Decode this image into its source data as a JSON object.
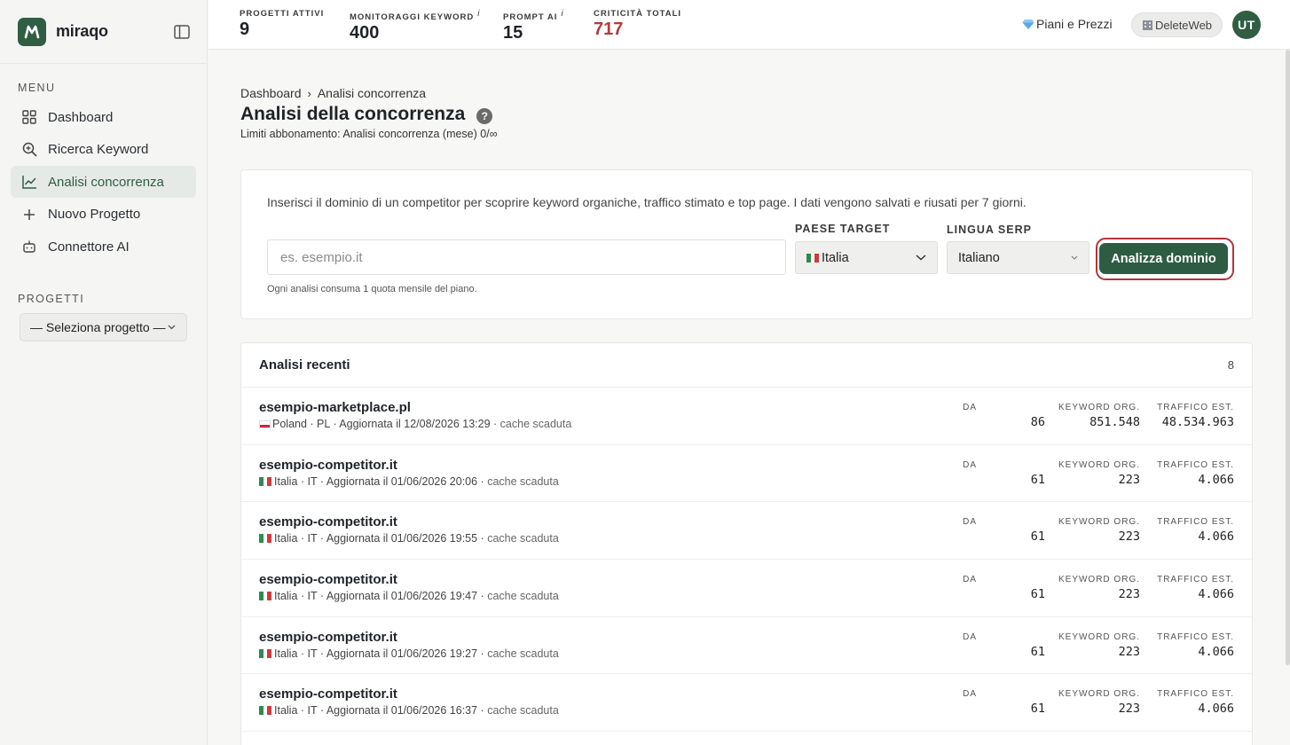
{
  "brand": {
    "name": "miraqo"
  },
  "sidebar": {
    "menu_label": "MENU",
    "items": [
      {
        "label": "Dashboard",
        "icon": "grid-icon",
        "active": false
      },
      {
        "label": "Ricerca Keyword",
        "icon": "search-icon",
        "active": false
      },
      {
        "label": "Analisi concorrenza",
        "icon": "chart-line-icon",
        "active": true
      },
      {
        "label": "Nuovo Progetto",
        "icon": "plus-icon",
        "active": false
      },
      {
        "label": "Connettore AI",
        "icon": "robot-icon",
        "active": false
      }
    ],
    "projects_label": "PROGETTI",
    "project_select": "— Seleziona progetto —"
  },
  "topbar": {
    "stats": [
      {
        "label": "PROGETTI ATTIVI",
        "value": "9",
        "info": false
      },
      {
        "label": "MONITORAGGI KEYWORD",
        "value": "400",
        "info": true
      },
      {
        "label": "PROMPT AI",
        "value": "15",
        "info": true
      },
      {
        "label": "CRITICITÀ TOTALI",
        "value": "717",
        "info": false
      }
    ],
    "info_mark": "i",
    "plans_label": "Piani e Prezzi",
    "workspace": "DeleteWeb",
    "avatar_initials": "UT"
  },
  "page": {
    "breadcrumb": [
      "Dashboard",
      "Analisi concorrenza"
    ],
    "breadcrumb_sep": "›",
    "title": "Analisi della concorrenza",
    "help": "?",
    "limits": "Limiti abbonamento: Analisi concorrenza (mese) 0/∞"
  },
  "form": {
    "intro": "Inserisci il dominio di un competitor per scoprire keyword organiche, traffico stimato e top page. I dati vengono salvati e riusati per 7 giorni.",
    "domain_placeholder": "es. esempio.it",
    "country_label": "PAESE TARGET",
    "country_value": "Italia",
    "language_label": "LINGUA SERP",
    "language_value": "Italiano",
    "submit_label": "Analizza dominio",
    "note": "Ogni analisi consuma 1 quota mensile del piano."
  },
  "recent": {
    "title": "Analisi recenti",
    "count": "8",
    "labels": {
      "da": "DA",
      "keywords": "KEYWORD ORG.",
      "traffic": "TRAFFICO EST."
    },
    "rows": [
      {
        "domain": "esempio-marketplace.pl",
        "flag": "pl",
        "meta": "Poland · PL · Aggiornata il 12/08/2026 13:29 · ",
        "cache": "cache scaduta",
        "da": "86",
        "keywords": "851.548",
        "traffic": "48.534.963"
      },
      {
        "domain": "esempio-competitor.it",
        "flag": "it",
        "meta": "Italia · IT · Aggiornata il 01/06/2026 20:06 · ",
        "cache": "cache scaduta",
        "da": "61",
        "keywords": "223",
        "traffic": "4.066"
      },
      {
        "domain": "esempio-competitor.it",
        "flag": "it",
        "meta": "Italia · IT · Aggiornata il 01/06/2026 19:55 · ",
        "cache": "cache scaduta",
        "da": "61",
        "keywords": "223",
        "traffic": "4.066"
      },
      {
        "domain": "esempio-competitor.it",
        "flag": "it",
        "meta": "Italia · IT · Aggiornata il 01/06/2026 19:47 · ",
        "cache": "cache scaduta",
        "da": "61",
        "keywords": "223",
        "traffic": "4.066"
      },
      {
        "domain": "esempio-competitor.it",
        "flag": "it",
        "meta": "Italia · IT · Aggiornata il 01/06/2026 19:27 · ",
        "cache": "cache scaduta",
        "da": "61",
        "keywords": "223",
        "traffic": "4.066"
      },
      {
        "domain": "esempio-competitor.it",
        "flag": "it",
        "meta": "Italia · IT · Aggiornata il 01/06/2026 16:37 · ",
        "cache": "cache scaduta",
        "da": "61",
        "keywords": "223",
        "traffic": "4.066"
      }
    ]
  },
  "colors": {
    "brand_green": "#2f5e43",
    "critical_red": "#b43a3a",
    "focus_ring": "#b3343a"
  }
}
